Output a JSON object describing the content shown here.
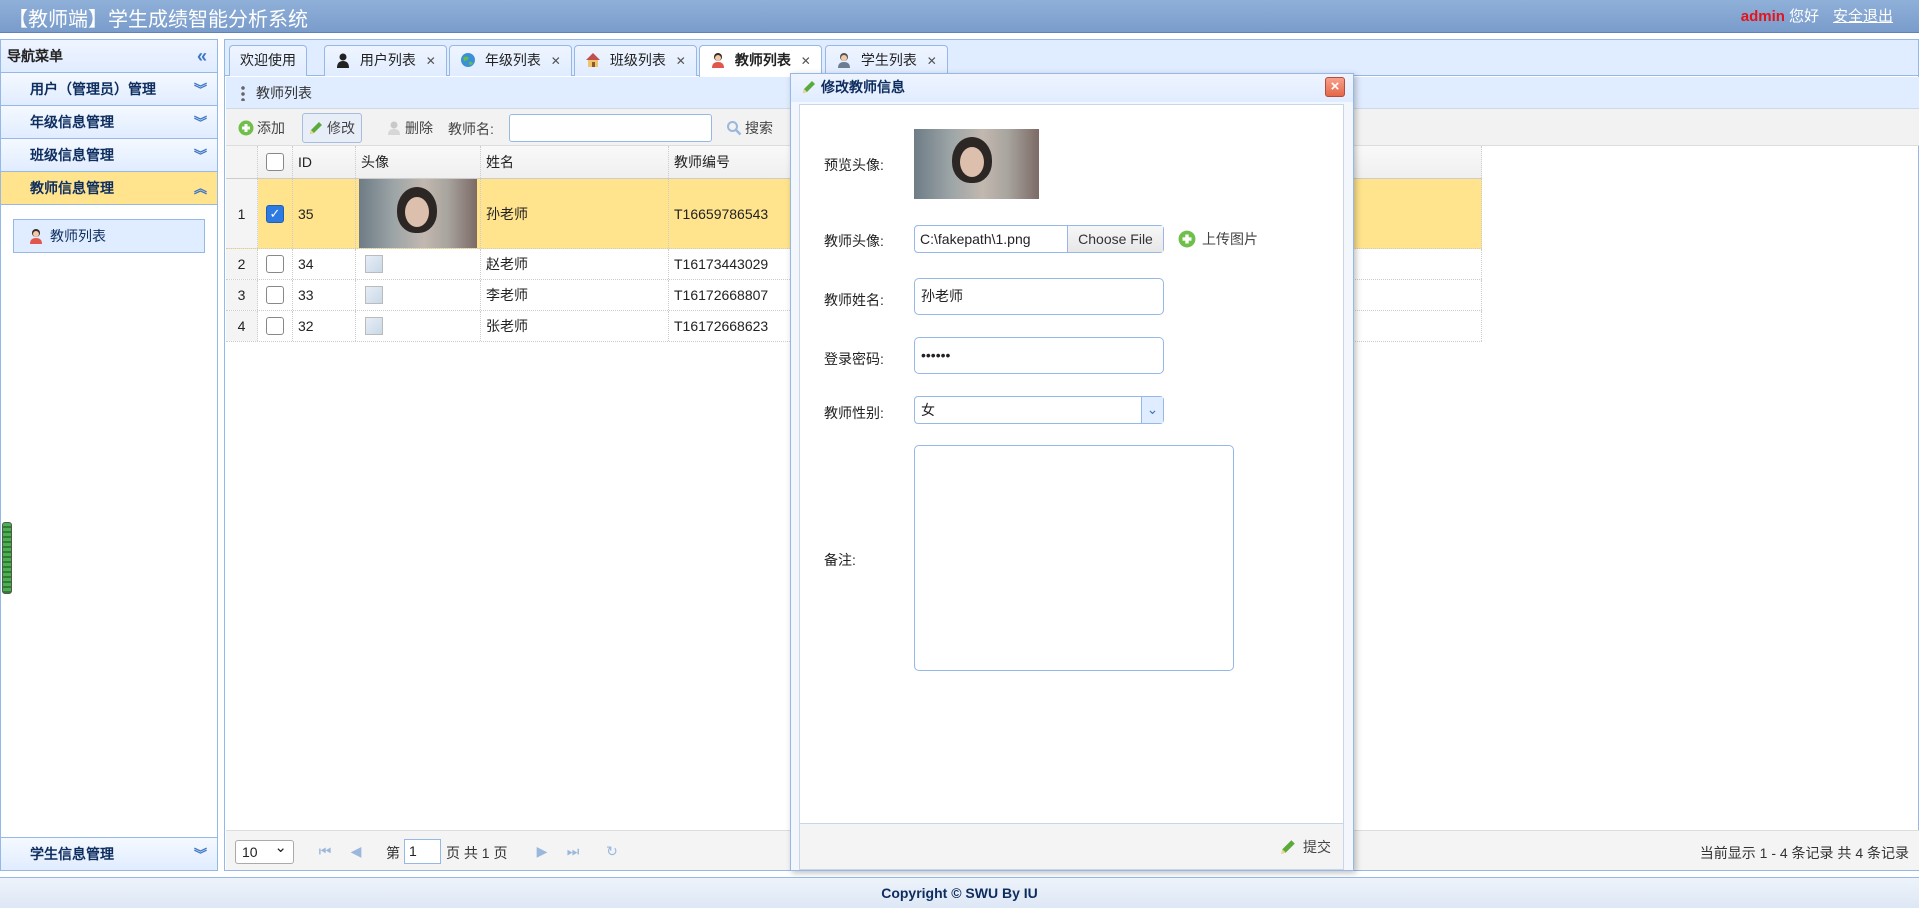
{
  "header": {
    "title": "【教师端】学生成绩智能分析系统",
    "user": "admin",
    "greeting": "您好",
    "logout": "安全退出"
  },
  "sidebar": {
    "title": "导航菜单",
    "sections": [
      {
        "label": "用户（管理员）管理"
      },
      {
        "label": "年级信息管理"
      },
      {
        "label": "班级信息管理"
      },
      {
        "label": "教师信息管理"
      }
    ],
    "active_item": "教师列表",
    "bottom_section": "学生信息管理"
  },
  "tabs": [
    {
      "label": "欢迎使用"
    },
    {
      "label": "用户列表"
    },
    {
      "label": "年级列表"
    },
    {
      "label": "班级列表"
    },
    {
      "label": "教师列表"
    },
    {
      "label": "学生列表"
    }
  ],
  "panel": {
    "title": "教师列表",
    "toolbar": {
      "add": "添加",
      "edit": "修改",
      "delete": "删除",
      "search_label": "教师名:",
      "search_button": "搜索"
    },
    "columns": [
      "ID",
      "头像",
      "姓名",
      "教师编号"
    ],
    "rows": [
      {
        "num": "1",
        "id": "35",
        "name": "孙老师",
        "code": "T16659786543",
        "checked": true
      },
      {
        "num": "2",
        "id": "34",
        "name": "赵老师",
        "code": "T16173443029",
        "checked": false
      },
      {
        "num": "3",
        "id": "33",
        "name": "李老师",
        "code": "T16172668807",
        "checked": false
      },
      {
        "num": "4",
        "id": "32",
        "name": "张老师",
        "code": "T16172668623",
        "checked": false
      }
    ],
    "pager": {
      "page_size": "10",
      "page_prefix": "第",
      "page_value": "1",
      "page_suffix": "页 共 1 页",
      "info": "当前显示 1 - 4 条记录 共 4 条记录"
    }
  },
  "modal": {
    "title": "修改教师信息",
    "preview_label": "预览头像:",
    "avatar_label": "教师头像:",
    "file_path": "C:\\fakepath\\1.png",
    "choose_file": "Choose File",
    "upload": "上传图片",
    "name_label": "教师姓名:",
    "name_value": "孙老师",
    "password_label": "登录密码:",
    "password_value": "••••••",
    "gender_label": "教师性别:",
    "gender_value": "女",
    "remark_label": "备注:",
    "submit": "提交"
  },
  "footer": {
    "copyright": "Copyright © SWU By IU"
  },
  "colors": {
    "header_bg": "#7a9ccb",
    "selected_row": "#ffe48d",
    "border": "#95b8e7",
    "username": "#e3141c"
  }
}
